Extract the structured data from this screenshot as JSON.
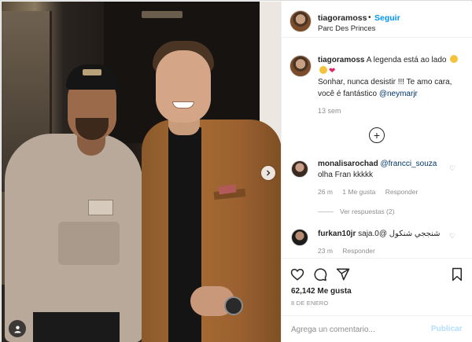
{
  "header": {
    "username": "tiagoramoss",
    "separator": "•",
    "follow_label": "Seguir",
    "location": "Parc Des Princes"
  },
  "caption": {
    "username": "tiagoramoss",
    "line1": "A legenda está ao lado",
    "line2": "Sonhar, nunca desistir !!! Te amo cara, você é fantástico",
    "mention": "@neymarjr",
    "time": "13 sem"
  },
  "comments": [
    {
      "username": "monalisarochad",
      "mention": "@francci_souza",
      "text": "olha Fran kkkkk",
      "time": "26 m",
      "likes": "1 Me gusta",
      "reply_label": "Responder",
      "view_replies": "Ver respuestas (2)"
    },
    {
      "username": "furkan10jr",
      "text": "saja.شنججي شنكول @0",
      "time": "23 m",
      "reply_label": "Responder"
    }
  ],
  "actions": {
    "likes": "62,142 Me gusta",
    "date": "8 DE ENERO"
  },
  "add_comment": {
    "placeholder": "Agrega un comentario...",
    "post_label": "Publicar"
  },
  "colors": {
    "link_blue": "#0095f6",
    "mention_blue": "#00376b",
    "post_disabled": "#b2dffc",
    "heart_red": "#e0245e"
  },
  "icons": {
    "heart": "heart-icon",
    "comment": "comment-icon",
    "share": "share-icon",
    "save": "bookmark-icon",
    "load_more": "plus-circle-icon",
    "user_tag": "user-tag-icon",
    "next": "chevron-right-icon"
  }
}
